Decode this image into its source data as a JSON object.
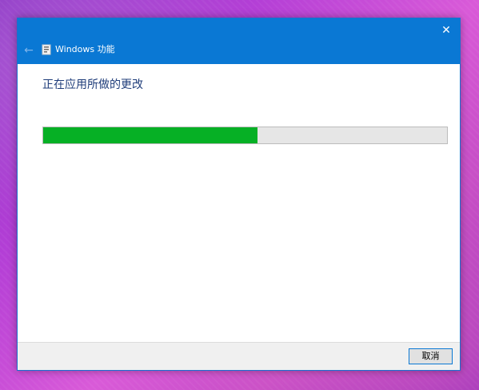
{
  "window": {
    "title": "Windows 功能",
    "heading": "正在应用所做的更改",
    "progress_percent": 53,
    "cancel_label": "取消"
  },
  "icons": {
    "close": "close-icon",
    "back": "back-arrow-icon",
    "app": "windows-features-icon"
  },
  "colors": {
    "titlebar": "#0a78d4",
    "progress_fill": "#06b025",
    "progress_track": "#e6e6e6",
    "heading_text": "#1f3d7a"
  }
}
